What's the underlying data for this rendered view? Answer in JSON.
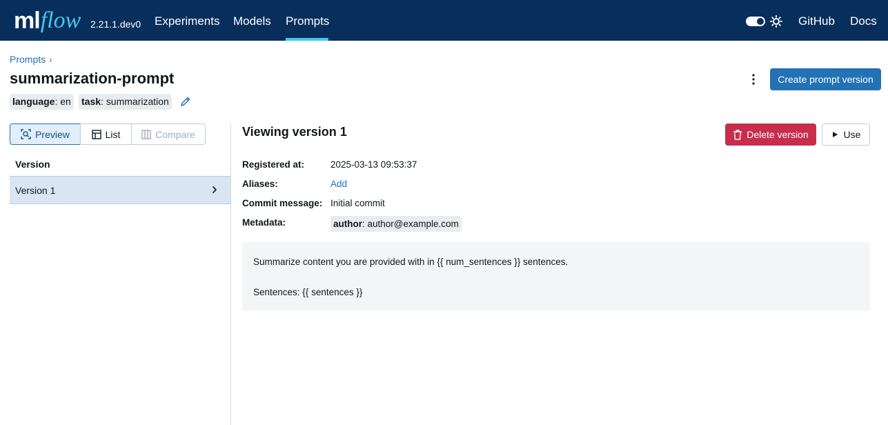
{
  "nav": {
    "logo_ml": "ml",
    "logo_flow": "flow",
    "version": "2.21.1.dev0",
    "items": [
      "Experiments",
      "Models",
      "Prompts"
    ],
    "active": "Prompts",
    "github": "GitHub",
    "docs": "Docs"
  },
  "header": {
    "breadcrumb": "Prompts",
    "breadcrumb_sep": "›",
    "title": "summarization-prompt",
    "tags": [
      {
        "key": "language",
        "value": ": en"
      },
      {
        "key": "task",
        "value": ": summarization"
      }
    ],
    "create_button": "Create prompt version"
  },
  "mode": {
    "preview": "Preview",
    "list": "List",
    "compare": "Compare"
  },
  "versions": {
    "column_header": "Version",
    "items": [
      {
        "label": "Version 1"
      }
    ]
  },
  "detail": {
    "title": "Viewing version 1",
    "delete_button": "Delete version",
    "use_button": "Use",
    "fields": {
      "registered_label": "Registered at:",
      "registered_value": "2025-03-13 09:53:37",
      "aliases_label": "Aliases:",
      "aliases_add": "Add",
      "commit_label": "Commit message:",
      "commit_value": "Initial commit",
      "metadata_label": "Metadata:",
      "metadata_key": "author",
      "metadata_value": ": author@example.com"
    },
    "prompt_lines": [
      "Summarize content you are provided with in {{ num_sentences }} sentences.",
      "Sentences: {{ sentences }}"
    ]
  },
  "colors": {
    "topbar": "#082f5c",
    "accent": "#43c9ed",
    "primary": "#2272b4",
    "danger": "#c82d4c"
  }
}
